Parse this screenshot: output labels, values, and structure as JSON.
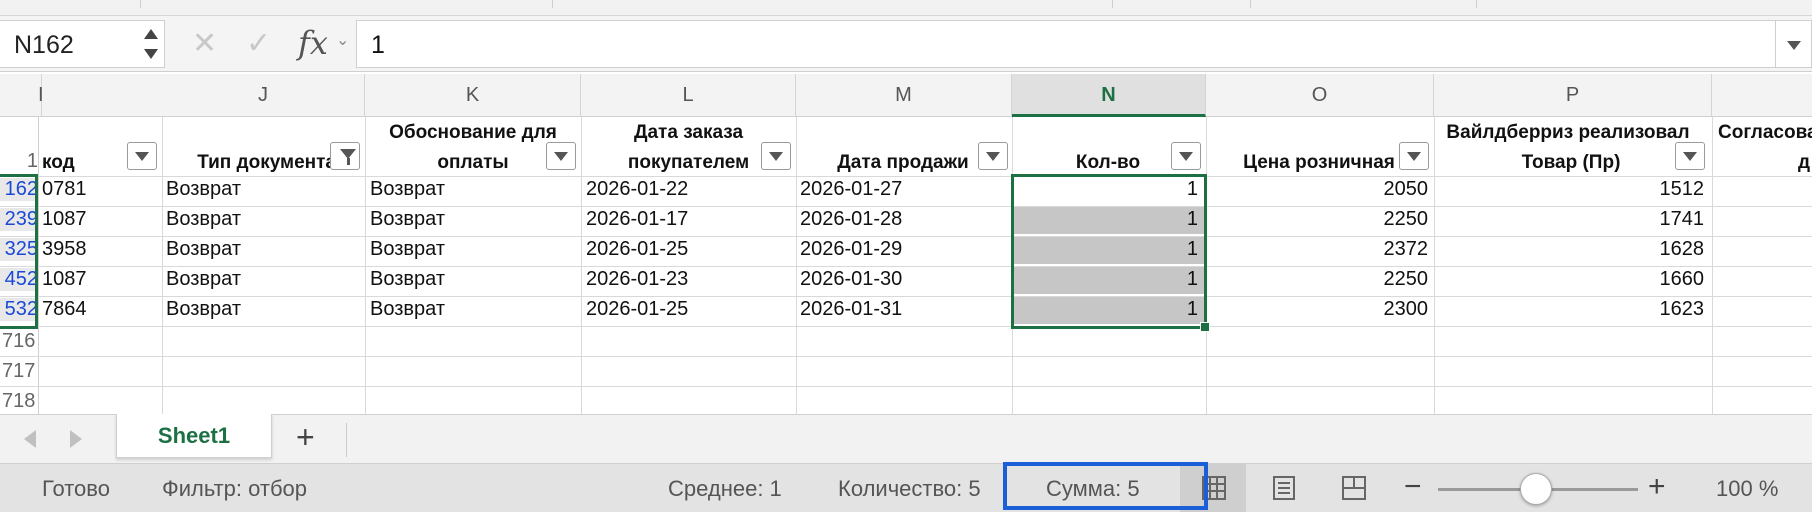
{
  "name_box": "N162",
  "formula": {
    "fx_label": "fx",
    "value": "1"
  },
  "columns": [
    {
      "letter": "I"
    },
    {
      "letter": "J"
    },
    {
      "letter": "K"
    },
    {
      "letter": "L"
    },
    {
      "letter": "M"
    },
    {
      "letter": "N"
    },
    {
      "letter": "O"
    },
    {
      "letter": "P"
    }
  ],
  "header_row_number": "1",
  "headers": {
    "I": "код",
    "J": "Тип документа",
    "K1": "Обоснование для",
    "K2": "оплаты",
    "L1": "Дата заказа",
    "L2": "покупателем",
    "M": "Дата продажи",
    "N": "Кол-во",
    "O": "Цена розничная",
    "P1": "Вайлдберриз реализовал",
    "P2": "Товар (Пр)",
    "Q1": "Согласова",
    "Q2": "д"
  },
  "rows": [
    {
      "num": "162",
      "i": "0781",
      "j": "Возврат",
      "k": "Возврат",
      "l": "2026-01-22",
      "m": "2026-01-27",
      "n": "1",
      "o": "2050",
      "p": "1512"
    },
    {
      "num": "239",
      "i": "1087",
      "j": "Возврат",
      "k": "Возврат",
      "l": "2026-01-17",
      "m": "2026-01-28",
      "n": "1",
      "o": "2250",
      "p": "1741"
    },
    {
      "num": "325",
      "i": "3958",
      "j": "Возврат",
      "k": "Возврат",
      "l": "2026-01-25",
      "m": "2026-01-29",
      "n": "1",
      "o": "2372",
      "p": "1628"
    },
    {
      "num": "452",
      "i": "1087",
      "j": "Возврат",
      "k": "Возврат",
      "l": "2026-01-23",
      "m": "2026-01-30",
      "n": "1",
      "o": "2250",
      "p": "1660"
    },
    {
      "num": "532",
      "i": "7864",
      "j": "Возврат",
      "k": "Возврат",
      "l": "2026-01-25",
      "m": "2026-01-31",
      "n": "1",
      "o": "2300",
      "p": "1623"
    }
  ],
  "empty_rows": [
    "716",
    "717",
    "718"
  ],
  "sheet_tab": "Sheet1",
  "add_sheet": "+",
  "status": {
    "ready": "Готово",
    "filter": "Фильтр: отбор",
    "average": "Среднее: 1",
    "count": "Количество: 5",
    "sum": "Сумма: 5",
    "zoom_minus": "−",
    "zoom_plus": "+",
    "zoom": "100 %"
  },
  "zoom_level": 1.0,
  "colors": {
    "accent": "#1d7044",
    "link": "#1b49d6",
    "highlight_box": "#1a5fd8"
  }
}
